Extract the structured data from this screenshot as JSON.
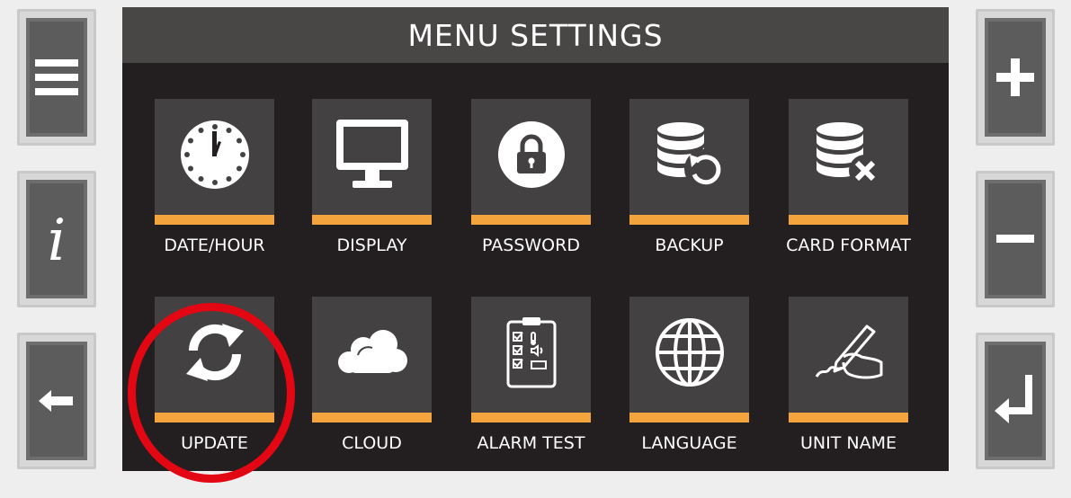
{
  "screen": {
    "title": "MENU SETTINGS",
    "accent_color": "#f3a43c",
    "tiles": [
      {
        "label": "DATE/HOUR",
        "icon": "clock-icon"
      },
      {
        "label": "DISPLAY",
        "icon": "monitor-icon"
      },
      {
        "label": "PASSWORD",
        "icon": "lock-icon"
      },
      {
        "label": "BACKUP",
        "icon": "database-restore-icon"
      },
      {
        "label": "CARD FORMAT",
        "icon": "database-delete-icon"
      },
      {
        "label": "UPDATE",
        "icon": "refresh-icon"
      },
      {
        "label": "CLOUD",
        "icon": "cloud-icon"
      },
      {
        "label": "ALARM TEST",
        "icon": "checklist-icon"
      },
      {
        "label": "LANGUAGE",
        "icon": "globe-icon"
      },
      {
        "label": "UNIT NAME",
        "icon": "signature-icon"
      }
    ]
  },
  "left_buttons": [
    {
      "icon": "menu-icon"
    },
    {
      "icon": "info-icon",
      "glyph": "i"
    },
    {
      "icon": "back-arrow-icon"
    }
  ],
  "right_buttons": [
    {
      "icon": "plus-icon"
    },
    {
      "icon": "minus-icon"
    },
    {
      "icon": "enter-icon"
    }
  ],
  "highlight": {
    "target": "UPDATE",
    "color": "#e30613"
  }
}
